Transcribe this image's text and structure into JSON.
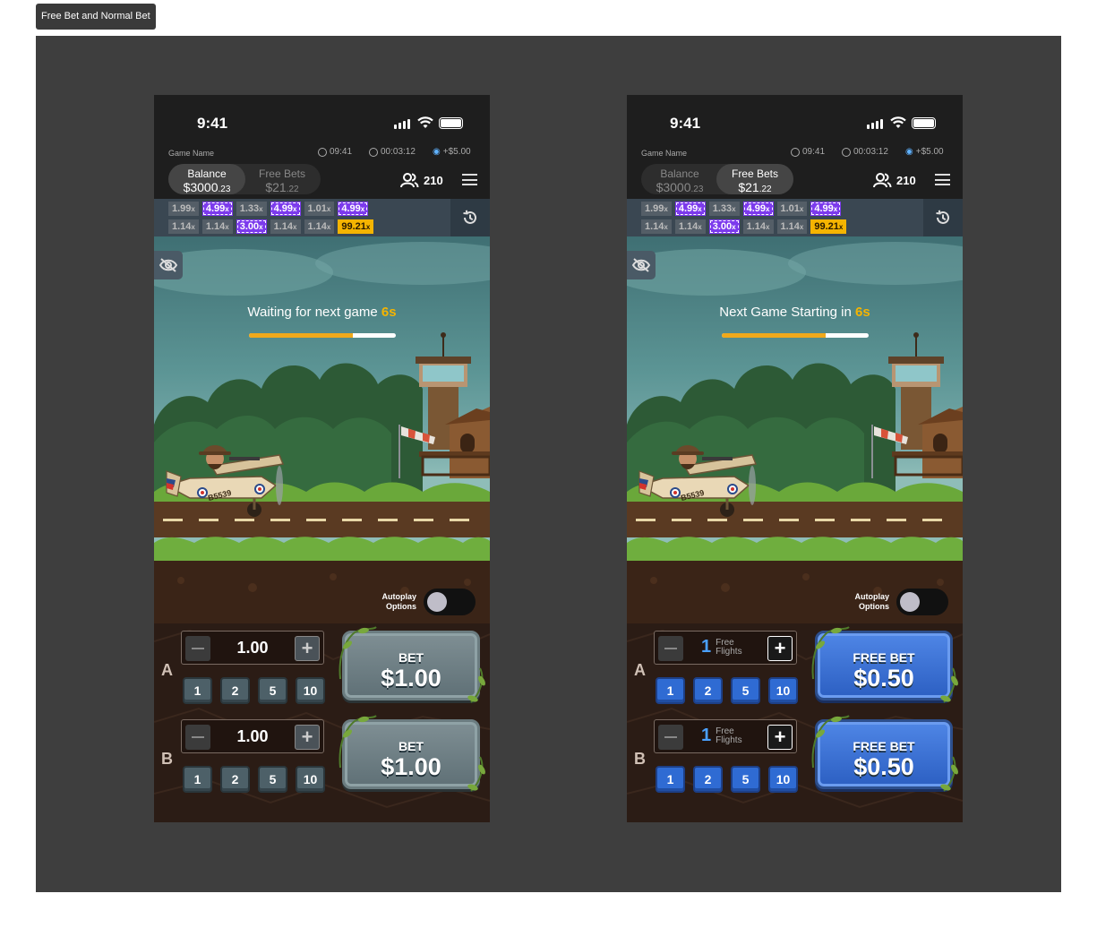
{
  "frame_label": "Free Bet and Normal Bet",
  "phones": [
    {
      "status_time": "9:41",
      "game_name": "Game Name",
      "clock": "09:41",
      "timer": "00:03:12",
      "credit": "+$5.00",
      "balance_label": "Balance",
      "balance_main": "$3000",
      "balance_cents": ".23",
      "freebets_label": "Free Bets",
      "freebets_main": "$21",
      "freebets_cents": ".22",
      "active_tab": "balance",
      "players": "210",
      "history_row1": [
        "1.99",
        "4.99",
        "1.33",
        "4.99",
        "1.01",
        "4.99"
      ],
      "history_row2": [
        "1.14",
        "1.14",
        "3.00",
        "1.14",
        "1.14",
        "99.21"
      ],
      "wait_text": "Waiting for next game ",
      "wait_secs": "6s",
      "progress": 0.71,
      "autoplay_line1": "Autoplay",
      "autoplay_line2": "Options",
      "bets": [
        {
          "letter": "A",
          "value": "1.00",
          "quick": [
            "1",
            "2",
            "5",
            "10"
          ],
          "btn_line1": "BET",
          "btn_line2": "$1.00"
        },
        {
          "letter": "B",
          "value": "1.00",
          "quick": [
            "1",
            "2",
            "5",
            "10"
          ],
          "btn_line1": "BET",
          "btn_line2": "$1.00"
        }
      ]
    },
    {
      "status_time": "9:41",
      "game_name": "Game Name",
      "clock": "09:41",
      "timer": "00:03:12",
      "credit": "+$5.00",
      "balance_label": "Balance",
      "balance_main": "$3000",
      "balance_cents": ".23",
      "freebets_label": "Free Bets",
      "freebets_main": "$21",
      "freebets_cents": ".22",
      "active_tab": "freebets",
      "players": "210",
      "history_row1": [
        "1.99",
        "4.99",
        "1.33",
        "4.99",
        "1.01",
        "4.99"
      ],
      "history_row2": [
        "1.14",
        "1.14",
        "3.00",
        "1.14",
        "1.14",
        "99.21"
      ],
      "wait_text": "Next Game Starting in ",
      "wait_secs": "6s",
      "progress": 0.71,
      "autoplay_line1": "Autoplay",
      "autoplay_line2": "Options",
      "bets": [
        {
          "letter": "A",
          "value": "1",
          "free_line1": "Free",
          "free_line2": "Flights",
          "quick": [
            "1",
            "2",
            "5",
            "10"
          ],
          "btn_line1": "FREE BET",
          "btn_line2": "$0.50"
        },
        {
          "letter": "B",
          "value": "1",
          "free_line1": "Free",
          "free_line2": "Flights",
          "quick": [
            "1",
            "2",
            "5",
            "10"
          ],
          "btn_line1": "FREE BET",
          "btn_line2": "$0.50"
        }
      ]
    }
  ],
  "plane_reg": "B5539",
  "colors": {
    "accent_orange": "#f5b400",
    "purple_chip": "#7c3aed",
    "free_blue": "#2f6bd3"
  }
}
